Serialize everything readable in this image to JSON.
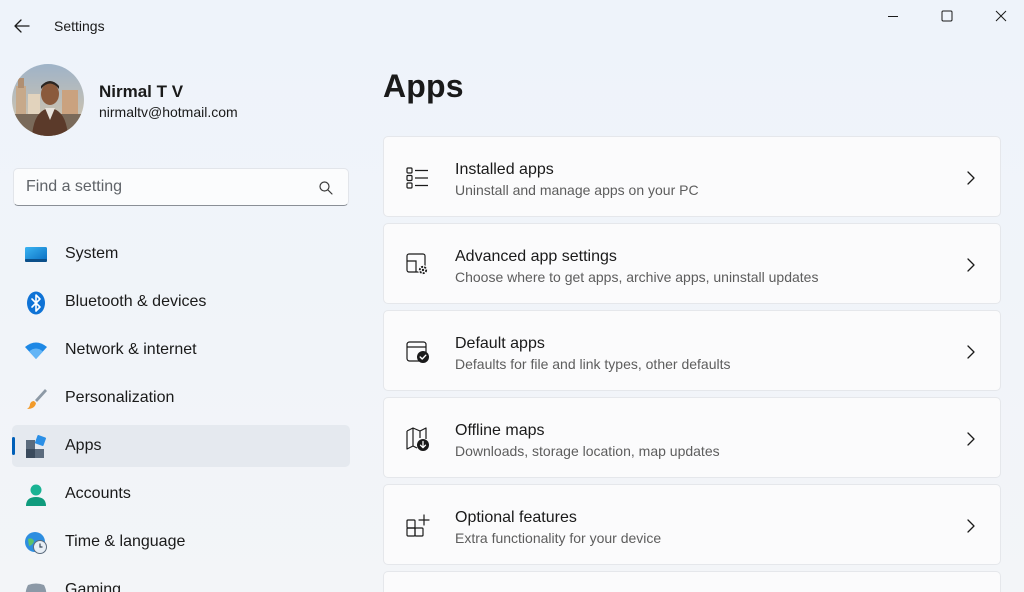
{
  "window": {
    "title": "Settings",
    "minimize_glyph": "—",
    "maximize_glyph": "☐",
    "close_glyph": "✕"
  },
  "profile": {
    "name": "Nirmal T V",
    "email": "nirmaltv@hotmail.com"
  },
  "search": {
    "placeholder": "Find a setting",
    "value": ""
  },
  "sidebar": {
    "items": [
      {
        "label": "System",
        "icon": "monitor-icon",
        "selected": false
      },
      {
        "label": "Bluetooth & devices",
        "icon": "bluetooth-icon",
        "selected": false
      },
      {
        "label": "Network & internet",
        "icon": "wifi-icon",
        "selected": false
      },
      {
        "label": "Personalization",
        "icon": "brush-icon",
        "selected": false
      },
      {
        "label": "Apps",
        "icon": "apps-icon",
        "selected": true
      },
      {
        "label": "Accounts",
        "icon": "person-icon",
        "selected": false
      },
      {
        "label": "Time & language",
        "icon": "globe-clock-icon",
        "selected": false
      },
      {
        "label": "Gaming",
        "icon": "gamepad-icon",
        "selected": false
      }
    ]
  },
  "main": {
    "title": "Apps",
    "cards": [
      {
        "title": "Installed apps",
        "description": "Uninstall and manage apps on your PC",
        "icon": "list-icon"
      },
      {
        "title": "Advanced app settings",
        "description": "Choose where to get apps, archive apps, uninstall updates",
        "icon": "app-settings-icon"
      },
      {
        "title": "Default apps",
        "description": "Defaults for file and link types, other defaults",
        "icon": "default-apps-icon"
      },
      {
        "title": "Offline maps",
        "description": "Downloads, storage location, map updates",
        "icon": "map-download-icon"
      },
      {
        "title": "Optional features",
        "description": "Extra functionality for your device",
        "icon": "grid-add-icon"
      }
    ]
  },
  "colors": {
    "accent": "#005fb8",
    "selected_bg": "#e5e9ef",
    "card_bg": "#fbfbfc"
  }
}
